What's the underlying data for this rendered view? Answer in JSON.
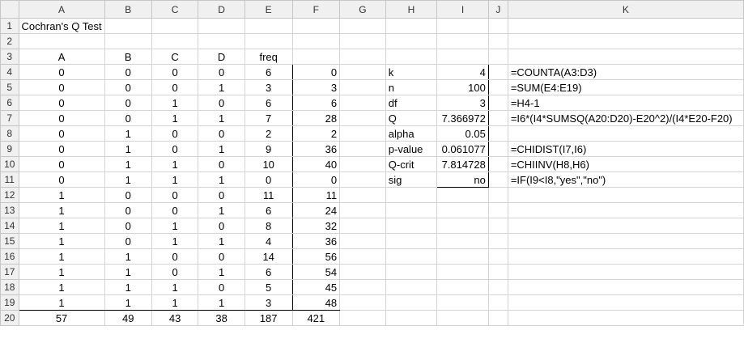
{
  "columns": [
    "A",
    "B",
    "C",
    "D",
    "E",
    "F",
    "G",
    "H",
    "I",
    "J",
    "K"
  ],
  "rows": [
    {
      "num": "1",
      "cells": {
        "A": "Cochran's Q Test"
      }
    },
    {
      "num": "2",
      "cells": {}
    },
    {
      "num": "3",
      "cells": {
        "A": "A",
        "B": "B",
        "C": "C",
        "D": "D",
        "E": "freq"
      }
    },
    {
      "num": "4",
      "cells": {
        "A": "0",
        "B": "0",
        "C": "0",
        "D": "0",
        "E": "6",
        "F": "0",
        "H": "k",
        "I": "4",
        "K": "=COUNTA(A3:D3)"
      }
    },
    {
      "num": "5",
      "cells": {
        "A": "0",
        "B": "0",
        "C": "0",
        "D": "1",
        "E": "3",
        "F": "3",
        "H": "n",
        "I": "100",
        "K": "=SUM(E4:E19)"
      }
    },
    {
      "num": "6",
      "cells": {
        "A": "0",
        "B": "0",
        "C": "1",
        "D": "0",
        "E": "6",
        "F": "6",
        "H": "df",
        "I": "3",
        "K": "=H4-1"
      }
    },
    {
      "num": "7",
      "cells": {
        "A": "0",
        "B": "0",
        "C": "1",
        "D": "1",
        "E": "7",
        "F": "28",
        "H": "Q",
        "I": "7.366972",
        "K": "=I6*(I4*SUMSQ(A20:D20)-E20^2)/(I4*E20-F20)"
      }
    },
    {
      "num": "8",
      "cells": {
        "A": "0",
        "B": "1",
        "C": "0",
        "D": "0",
        "E": "2",
        "F": "2",
        "H": "alpha",
        "I": "0.05"
      }
    },
    {
      "num": "9",
      "cells": {
        "A": "0",
        "B": "1",
        "C": "0",
        "D": "1",
        "E": "9",
        "F": "36",
        "H": "p-value",
        "I": "0.061077",
        "K": "=CHIDIST(I7,I6)"
      }
    },
    {
      "num": "10",
      "cells": {
        "A": "0",
        "B": "1",
        "C": "1",
        "D": "0",
        "E": "10",
        "F": "40",
        "H": "Q-crit",
        "I": "7.814728",
        "K": "=CHIINV(H8,H6)"
      }
    },
    {
      "num": "11",
      "cells": {
        "A": "0",
        "B": "1",
        "C": "1",
        "D": "1",
        "E": "0",
        "F": "0",
        "H": "sig",
        "I": "no",
        "K": "=IF(I9<I8,\"yes\",\"no\")"
      }
    },
    {
      "num": "12",
      "cells": {
        "A": "1",
        "B": "0",
        "C": "0",
        "D": "0",
        "E": "11",
        "F": "11"
      }
    },
    {
      "num": "13",
      "cells": {
        "A": "1",
        "B": "0",
        "C": "0",
        "D": "1",
        "E": "6",
        "F": "24"
      }
    },
    {
      "num": "14",
      "cells": {
        "A": "1",
        "B": "0",
        "C": "1",
        "D": "0",
        "E": "8",
        "F": "32"
      }
    },
    {
      "num": "15",
      "cells": {
        "A": "1",
        "B": "0",
        "C": "1",
        "D": "1",
        "E": "4",
        "F": "36"
      }
    },
    {
      "num": "16",
      "cells": {
        "A": "1",
        "B": "1",
        "C": "0",
        "D": "0",
        "E": "14",
        "F": "56"
      }
    },
    {
      "num": "17",
      "cells": {
        "A": "1",
        "B": "1",
        "C": "0",
        "D": "1",
        "E": "6",
        "F": "54"
      }
    },
    {
      "num": "18",
      "cells": {
        "A": "1",
        "B": "1",
        "C": "1",
        "D": "0",
        "E": "5",
        "F": "45"
      }
    },
    {
      "num": "19",
      "cells": {
        "A": "1",
        "B": "1",
        "C": "1",
        "D": "1",
        "E": "3",
        "F": "48"
      }
    },
    {
      "num": "20",
      "cells": {
        "A": "57",
        "B": "49",
        "C": "43",
        "D": "38",
        "E": "187",
        "F": "421"
      }
    }
  ]
}
